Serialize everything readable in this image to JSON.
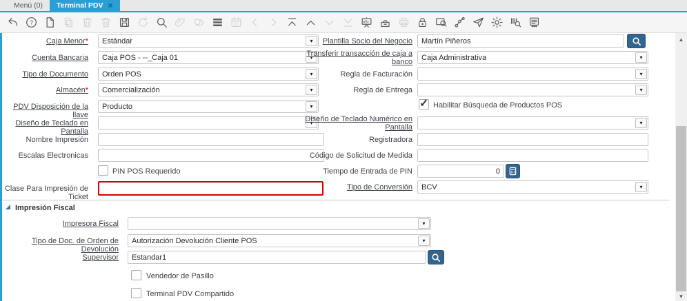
{
  "tabs": {
    "menu": {
      "label": "Menú (0)"
    },
    "terminal": {
      "label": "Terminal PDV",
      "close": "×"
    }
  },
  "toolbar": {
    "icons": [
      {
        "name": "undo",
        "icon": "undo",
        "enabled": true
      },
      {
        "name": "help",
        "icon": "help",
        "enabled": true
      },
      {
        "name": "new-record",
        "icon": "file",
        "enabled": true
      },
      {
        "name": "copy-record",
        "icon": "copy",
        "enabled": false
      },
      {
        "name": "delete-record",
        "icon": "trash",
        "enabled": false
      },
      {
        "name": "delete-selection",
        "icon": "trash",
        "enabled": false
      },
      {
        "name": "save",
        "icon": "save",
        "enabled": true
      },
      {
        "name": "refresh",
        "icon": "refresh",
        "enabled": false
      },
      {
        "name": "find",
        "icon": "search",
        "enabled": true
      },
      {
        "name": "attachment",
        "icon": "clip",
        "enabled": false
      },
      {
        "name": "chat",
        "icon": "chat",
        "enabled": false
      },
      {
        "name": "grid-toggle",
        "icon": "bars",
        "enabled": true
      },
      {
        "name": "history",
        "icon": "calendar",
        "enabled": false
      },
      {
        "name": "previous-record",
        "icon": "chevl",
        "enabled": false
      },
      {
        "name": "next-record",
        "icon": "chevr",
        "enabled": false
      },
      {
        "name": "first-record",
        "icon": "first",
        "enabled": true
      },
      {
        "name": "parent-record",
        "icon": "chevu",
        "enabled": true
      },
      {
        "name": "detail-record",
        "icon": "chevd",
        "enabled": false
      },
      {
        "name": "last-record",
        "icon": "last",
        "enabled": false
      },
      {
        "name": "workflow-window",
        "icon": "board",
        "enabled": true
      },
      {
        "name": "archive",
        "icon": "archive",
        "enabled": true
      },
      {
        "name": "print",
        "icon": "printer",
        "enabled": false
      },
      {
        "name": "lock",
        "icon": "lock",
        "enabled": true
      },
      {
        "name": "zoom-across",
        "icon": "zoomwin",
        "enabled": true
      },
      {
        "name": "check-workflow",
        "icon": "workflow",
        "enabled": true
      },
      {
        "name": "request",
        "icon": "send",
        "enabled": true
      },
      {
        "name": "process",
        "icon": "gear",
        "enabled": true
      },
      {
        "name": "product-info",
        "icon": "prodsearch",
        "enabled": true
      },
      {
        "name": "report",
        "icon": "report",
        "enabled": true
      }
    ]
  },
  "form": {
    "fields": {
      "caja_menor": {
        "label": "Caja Menor",
        "required": "*",
        "value": "Estándar"
      },
      "plantilla_socio": {
        "label": "Plantilla Socio del Negocio",
        "value": "Martín Piñeros"
      },
      "cuenta_bancaria": {
        "label": "Cuenta Bancaria",
        "value": "Caja POS - --_Caja 01"
      },
      "transferir": {
        "label": "Transferir transacción de caja a banco",
        "value": "Caja Administrativa"
      },
      "tipo_documento": {
        "label": "Tipo de Documento",
        "value": "Orden POS"
      },
      "regla_facturacion": {
        "label": "Regla de Facturación",
        "value": ""
      },
      "almacen": {
        "label": "Almacén",
        "required": "*",
        "value": "Comercialización"
      },
      "regla_entrega": {
        "label": "Regla de Entrega",
        "value": ""
      },
      "pdv_disposicion": {
        "label": "PDV Disposición de la llave",
        "value": "Producto"
      },
      "habilitar_busqueda": {
        "label": "Habilitar Búsqueda de Productos POS",
        "checked": true
      },
      "diseno_teclado": {
        "label": "Diseño de Teclado en Pantalla",
        "value": ""
      },
      "diseno_teclado_num": {
        "label": "Diseño de Teclado Numérico en Pantalla",
        "value": ""
      },
      "nombre_impresion": {
        "label": "Nombre Impresión",
        "value": ""
      },
      "registradora": {
        "label": "Registradora",
        "value": ""
      },
      "escalas": {
        "label": "Escalas Electronicas",
        "value": ""
      },
      "codigo_solicitud": {
        "label": "Código de Solicitud de Medida",
        "value": ""
      },
      "pin_requerido": {
        "label": "PIN POS Requerido",
        "checked": false
      },
      "tiempo_pin": {
        "label": "Tiempo de Entrada de PIN",
        "value": "0"
      },
      "clase_ticket": {
        "label": "Clase Para Impresión de Ticket",
        "value": ""
      },
      "tipo_conversion": {
        "label": "Tipo de Conversión",
        "value": "BCV"
      }
    },
    "section": {
      "title": "Impresión Fiscal"
    },
    "fiscal": {
      "impresora_fiscal": {
        "label": "Impresora Fiscal",
        "value": ""
      },
      "tipo_doc_devolucion": {
        "label": "Tipo de Doc. de Orden de Devolución",
        "value": "Autorización Devolución Cliente POS"
      },
      "supervisor": {
        "label": "Supervisor",
        "value": "Estandar1"
      },
      "vendedor_pasillo": {
        "label": "Vendedor de Pasillo",
        "checked": false
      },
      "terminal_compartido": {
        "label": "Terminal PDV Compartido",
        "checked": false
      }
    }
  },
  "colors": {
    "accent": "#2b9fd4",
    "button_blue": "#32648d",
    "error_border": "#d40000",
    "required_red": "#cc0000"
  }
}
